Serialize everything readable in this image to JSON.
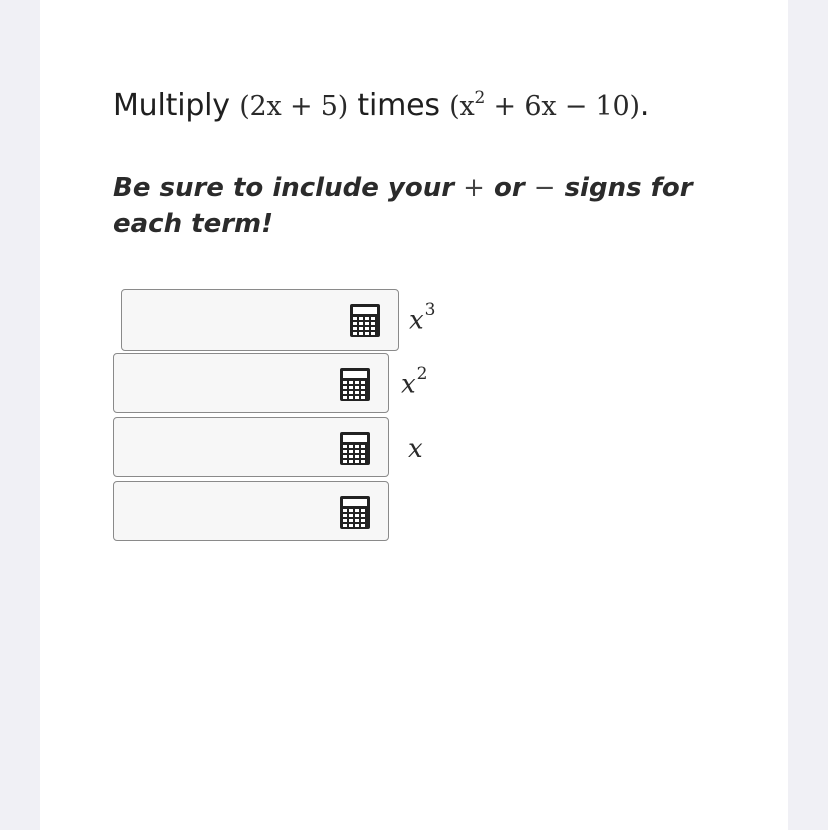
{
  "question": {
    "verb": "Multiply",
    "factor_a": "(2x + 5)",
    "joiner": "times",
    "factor_b_open": "(x",
    "factor_b_exp": "2",
    "factor_b_rest": " + 6x − 10)",
    "period": "."
  },
  "instruction": {
    "part1": "Be sure to include your",
    "plus": "+",
    "or": "or",
    "minus": "−",
    "part2": "signs for each term!"
  },
  "answers": [
    {
      "value": "",
      "label_base": "x",
      "label_exp": "3",
      "icon": "calculator-icon"
    },
    {
      "value": "",
      "label_base": "x",
      "label_exp": "2",
      "icon": "calculator-icon"
    },
    {
      "value": "",
      "label_base": "x",
      "label_exp": "",
      "icon": "calculator-icon"
    },
    {
      "value": "",
      "label_base": "",
      "label_exp": "",
      "icon": "calculator-icon"
    }
  ]
}
